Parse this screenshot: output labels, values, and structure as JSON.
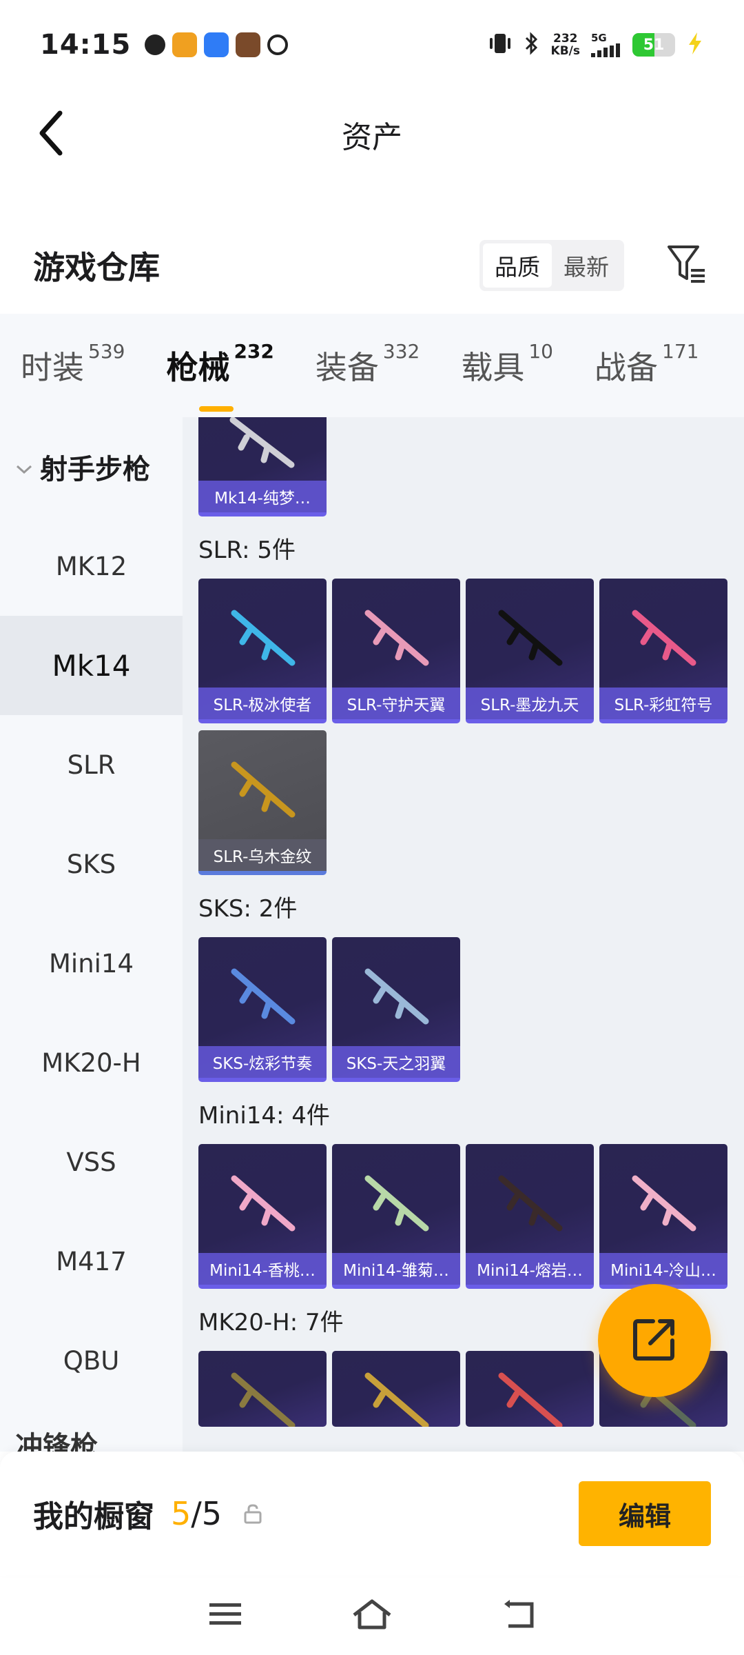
{
  "status_bar": {
    "time": "14:15",
    "net_speed_value": "232",
    "net_speed_unit": "KB/s",
    "network": "5G",
    "battery": "51"
  },
  "header": {
    "title": "资产"
  },
  "warehouse": {
    "title": "游戏仓库",
    "sort_options": [
      "品质",
      "最新"
    ],
    "sort_selected": "品质"
  },
  "tabs": [
    {
      "label": "时装",
      "count": "539"
    },
    {
      "label": "枪械",
      "count": "232"
    },
    {
      "label": "装备",
      "count": "332"
    },
    {
      "label": "载具",
      "count": "10"
    },
    {
      "label": "战备",
      "count": "171"
    }
  ],
  "active_tab": "枪械",
  "sidebar": {
    "group": "射手步枪",
    "items": [
      "MK12",
      "Mk14",
      "SLR",
      "SKS",
      "Mini14",
      "MK20-H",
      "VSS",
      "M417",
      "QBU"
    ],
    "selected": "Mk14",
    "next_group_partial": "冲锋枪"
  },
  "content": {
    "mk14_items": [
      "Mk14-纯梦…"
    ],
    "sections": [
      {
        "label": "SLR: 5件",
        "items": [
          {
            "name": "SLR-极冰使者",
            "color": "#3fb6e8"
          },
          {
            "name": "SLR-守护天翼",
            "color": "#e89ab8"
          },
          {
            "name": "SLR-墨龙九天",
            "color": "#2a2a2a"
          },
          {
            "name": "SLR-彩虹符号",
            "color": "#e85a8a"
          },
          {
            "name": "SLR-乌木金纹",
            "color": "#c8961e"
          }
        ]
      },
      {
        "label": "SKS: 2件",
        "items": [
          {
            "name": "SKS-炫彩节奏",
            "color": "#5a8ae0"
          },
          {
            "name": "SKS-天之羽翼",
            "color": "#9ab8d8"
          }
        ]
      },
      {
        "label": "Mini14: 4件",
        "items": [
          {
            "name": "Mini14-香桃…",
            "color": "#f0a8c8"
          },
          {
            "name": "Mini14-雏菊…",
            "color": "#b8d8a8"
          },
          {
            "name": "Mini14-熔岩…",
            "color": "#3a2a2a"
          },
          {
            "name": "Mini14-冷山…",
            "color": "#f0b0c8"
          }
        ]
      },
      {
        "label": "MK20-H: 7件",
        "items": [
          {
            "name": "",
            "color": "#8a7a40"
          },
          {
            "name": "",
            "color": "#c8a03a"
          },
          {
            "name": "",
            "color": "#d85050"
          },
          {
            "name": "",
            "color": "#5a6a5a"
          }
        ]
      }
    ]
  },
  "showcase": {
    "title": "我的橱窗",
    "current": "5",
    "separator": "/",
    "total": "5",
    "edit_label": "编辑"
  },
  "colors": {
    "accent": "#ffb000",
    "card_bg": "#2a2552",
    "card_label": "#6054d2"
  }
}
